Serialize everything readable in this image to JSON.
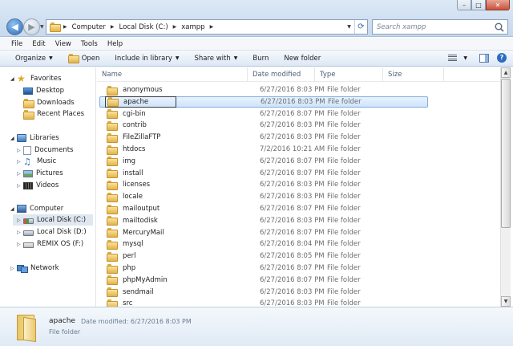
{
  "window": {
    "minimize": "–",
    "maximize": "□",
    "close": "✕"
  },
  "nav": {
    "back": "◀",
    "forward": "▶"
  },
  "address": {
    "crumbs": [
      "Computer",
      "Local Disk (C:)",
      "xampp"
    ]
  },
  "search": {
    "placeholder": "Search xampp"
  },
  "menu": [
    "File",
    "Edit",
    "View",
    "Tools",
    "Help"
  ],
  "toolbar": {
    "organize": "Organize",
    "open": "Open",
    "include": "Include in library",
    "share": "Share with",
    "burn": "Burn",
    "new_folder": "New folder"
  },
  "sidebar": {
    "favorites": "Favorites",
    "desktop": "Desktop",
    "downloads": "Downloads",
    "recent": "Recent Places",
    "libraries": "Libraries",
    "documents": "Documents",
    "music": "Music",
    "pictures": "Pictures",
    "videos": "Videos",
    "computer": "Computer",
    "local_c": "Local Disk (C:)",
    "local_d": "Local Disk (D:)",
    "remix": "REMIX OS (F:)",
    "network": "Network"
  },
  "columns": {
    "name": "Name",
    "date": "Date modified",
    "type": "Type",
    "size": "Size"
  },
  "files": [
    {
      "name": "anonymous",
      "date": "6/27/2016 8:03 PM",
      "type": "File folder"
    },
    {
      "name": "apache",
      "date": "6/27/2016 8:03 PM",
      "type": "File folder"
    },
    {
      "name": "cgi-bin",
      "date": "6/27/2016 8:07 PM",
      "type": "File folder"
    },
    {
      "name": "contrib",
      "date": "6/27/2016 8:03 PM",
      "type": "File folder"
    },
    {
      "name": "FileZillaFTP",
      "date": "6/27/2016 8:03 PM",
      "type": "File folder"
    },
    {
      "name": "htdocs",
      "date": "7/2/2016 10:21 AM",
      "type": "File folder"
    },
    {
      "name": "img",
      "date": "6/27/2016 8:07 PM",
      "type": "File folder"
    },
    {
      "name": "install",
      "date": "6/27/2016 8:07 PM",
      "type": "File folder"
    },
    {
      "name": "licenses",
      "date": "6/27/2016 8:03 PM",
      "type": "File folder"
    },
    {
      "name": "locale",
      "date": "6/27/2016 8:03 PM",
      "type": "File folder"
    },
    {
      "name": "mailoutput",
      "date": "6/27/2016 8:07 PM",
      "type": "File folder"
    },
    {
      "name": "mailtodisk",
      "date": "6/27/2016 8:03 PM",
      "type": "File folder"
    },
    {
      "name": "MercuryMail",
      "date": "6/27/2016 8:07 PM",
      "type": "File folder"
    },
    {
      "name": "mysql",
      "date": "6/27/2016 8:04 PM",
      "type": "File folder"
    },
    {
      "name": "perl",
      "date": "6/27/2016 8:05 PM",
      "type": "File folder"
    },
    {
      "name": "php",
      "date": "6/27/2016 8:07 PM",
      "type": "File folder"
    },
    {
      "name": "phpMyAdmin",
      "date": "6/27/2016 8:07 PM",
      "type": "File folder"
    },
    {
      "name": "sendmail",
      "date": "6/27/2016 8:03 PM",
      "type": "File folder"
    },
    {
      "name": "src",
      "date": "6/27/2016 8:03 PM",
      "type": "File folder"
    }
  ],
  "selected_index": 1,
  "details": {
    "name": "apache",
    "date_label": "Date modified: 6/27/2016 8:03 PM",
    "type": "File folder"
  },
  "colors": {
    "accent": "#2d69b4",
    "selection": "#cfe4fb",
    "selection_border": "#84acdd"
  }
}
